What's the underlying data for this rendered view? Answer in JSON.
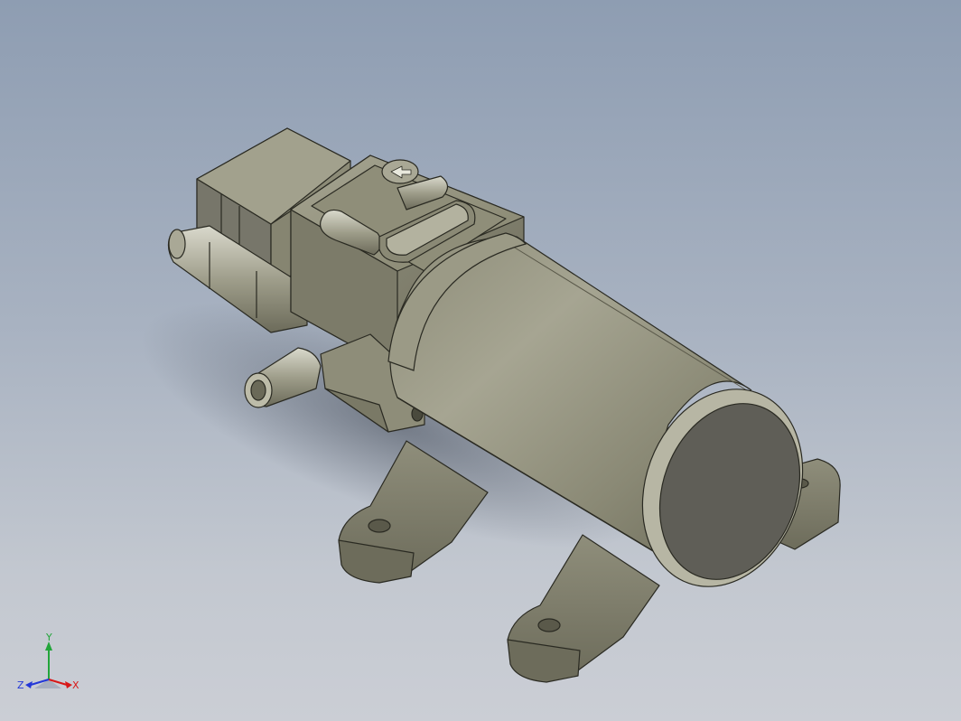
{
  "viewport": {
    "background_top": "#8e9db2",
    "background_bottom": "#cbced5",
    "model_color": "#85846f"
  },
  "triad": {
    "x_label": "X",
    "y_label": "Y",
    "z_label": "Z",
    "x_color": "#d81818",
    "y_color": "#22a53a",
    "z_color": "#2438d8"
  }
}
